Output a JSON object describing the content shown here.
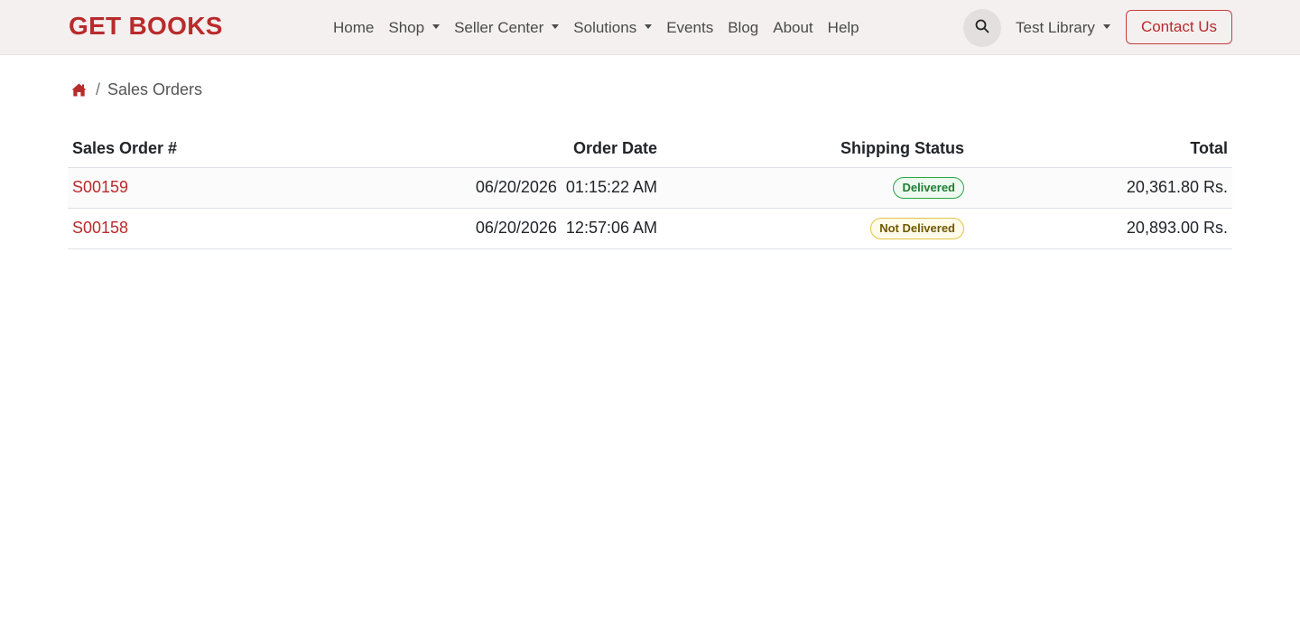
{
  "navbar": {
    "brand": "GET BOOKS",
    "items": [
      {
        "label": "Home",
        "dropdown": false
      },
      {
        "label": "Shop",
        "dropdown": true
      },
      {
        "label": "Seller Center",
        "dropdown": true
      },
      {
        "label": "Solutions",
        "dropdown": true
      },
      {
        "label": "Events",
        "dropdown": false
      },
      {
        "label": "Blog",
        "dropdown": false
      },
      {
        "label": "About",
        "dropdown": false
      },
      {
        "label": "Help",
        "dropdown": false
      }
    ],
    "user": "Test Library",
    "contact": "Contact Us",
    "search_icon": "search-icon"
  },
  "breadcrumb": {
    "home_icon": "home-icon",
    "separator": "/",
    "current": "Sales Orders"
  },
  "table": {
    "headers": [
      "Sales Order #",
      "Order Date",
      "Shipping Status",
      "Total"
    ],
    "rows": [
      {
        "order": "S00159",
        "date": "06/20/2026  01:15:22 AM",
        "status": "Delivered",
        "status_type": "green",
        "total": "20,361.80 Rs."
      },
      {
        "order": "S00158",
        "date": "06/20/2026  12:57:06 AM",
        "status": "Not Delivered",
        "status_type": "yellow",
        "total": "20,893.00 Rs."
      }
    ]
  },
  "colors": {
    "brand": "#b92b2b",
    "navbar_bg": "#f4f0f0",
    "delivered": "#28a745",
    "not_delivered": "#e0c341"
  }
}
